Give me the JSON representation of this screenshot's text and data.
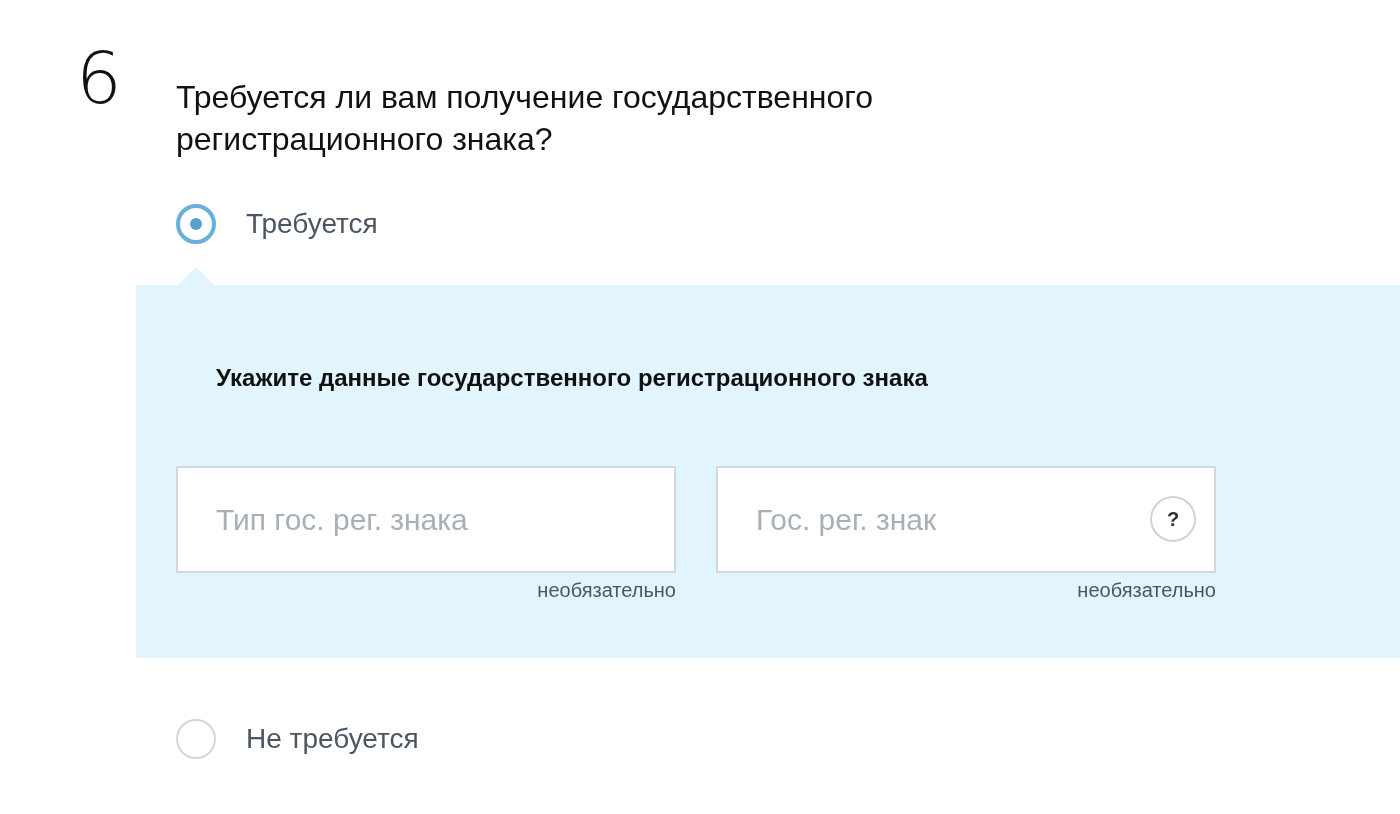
{
  "step": {
    "number": "6"
  },
  "question": "Требуется ли вам получение государственного регистрационного знака?",
  "options": [
    {
      "label": "Требуется",
      "selected": true,
      "details": {
        "heading": "Укажите данные государственного регистрационного знака",
        "fields": [
          {
            "placeholder": "Тип гос. рег. знака",
            "note": "необязательно"
          },
          {
            "placeholder": "Гос. рег. знак",
            "note": "необязательно",
            "help": "?"
          }
        ]
      }
    },
    {
      "label": "Не требуется",
      "selected": false
    }
  ]
}
